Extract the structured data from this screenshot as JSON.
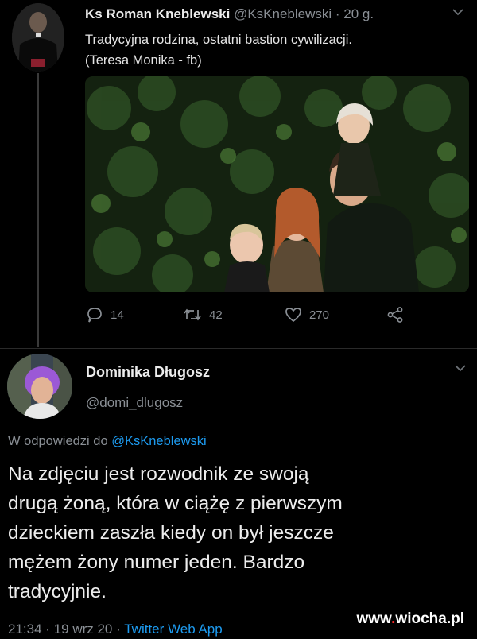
{
  "tweet": {
    "author_name": "Ks Roman Kneblewski",
    "author_handle": "@KsKneblewski",
    "separator": "·",
    "time": "20 g.",
    "text_lines": [
      "Tradycyjna rodzina, ostatni bastion cywilizacji.",
      "(Teresa Monika - fb)"
    ],
    "actions": {
      "replies": "14",
      "retweets": "42",
      "likes": "270"
    }
  },
  "reply": {
    "author_name": "Dominika Długosz",
    "author_handle": "@domi_dlugosz",
    "reply_prefix": "W odpowiedzi do",
    "reply_mention": "@KsKneblewski",
    "body_lines": [
      "Na zdjęciu jest rozwodnik ze swoją",
      "drugą żoną, która w ciążę z pierwszym",
      "dzieckiem zaszła kiedy on był jeszcze",
      "mężem żony numer jeden. Bardzo",
      "tradycyjnie."
    ],
    "time": "21:34",
    "date": "19 wrz 20",
    "dot": "·",
    "app": "Twitter Web App"
  },
  "watermark": {
    "www": "www",
    "dot": ".",
    "name": "wiocha",
    "tld": ".pl"
  },
  "colors": {
    "background": "#000000",
    "link": "#1d9bf0",
    "muted": "#8a8f95",
    "watermark_dot": "#ff2a2a"
  },
  "icons": [
    "reply-icon",
    "retweet-icon",
    "like-icon",
    "share-icon",
    "chevron-down-icon"
  ]
}
